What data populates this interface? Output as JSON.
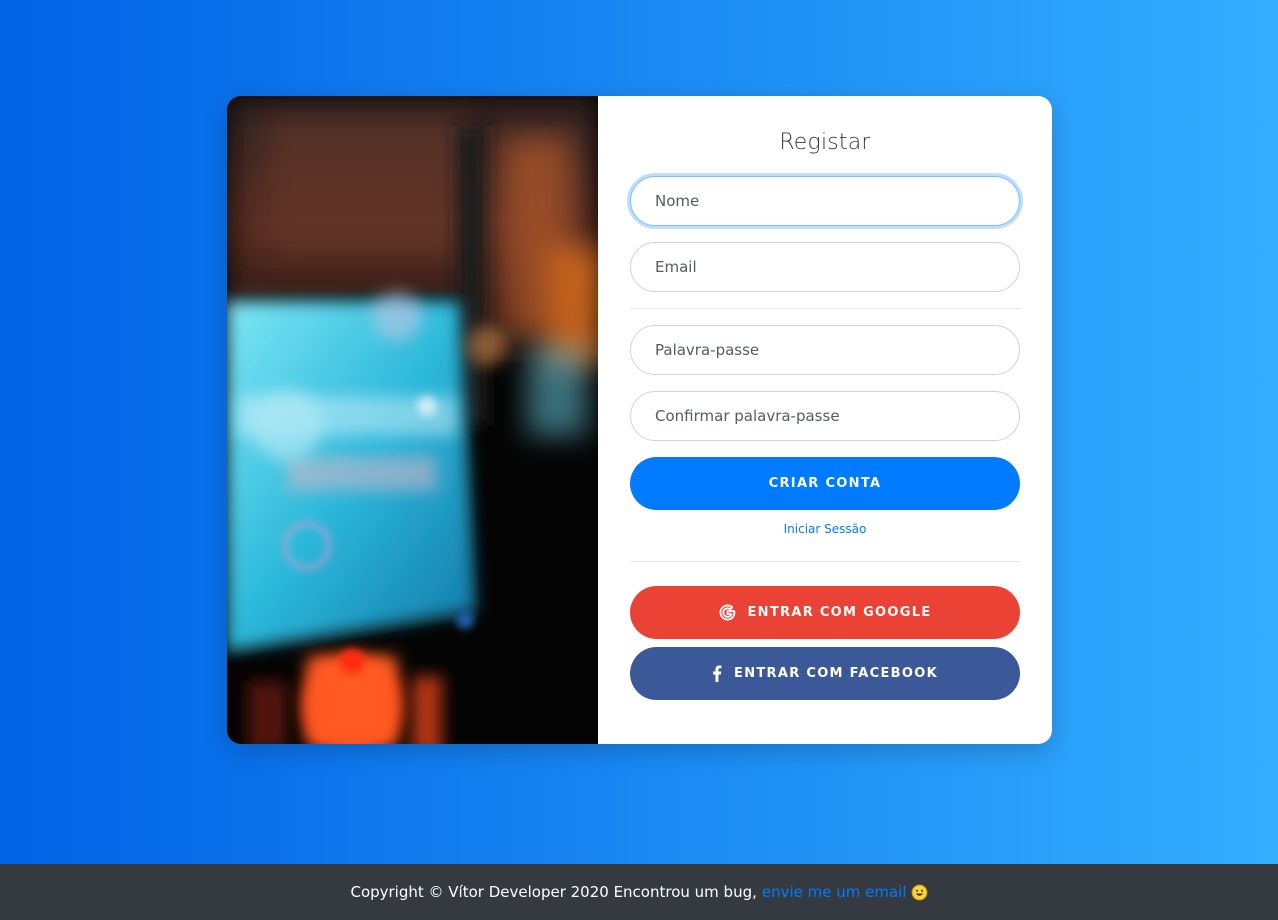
{
  "register": {
    "title": "Registar",
    "name_placeholder": "Nome",
    "email_placeholder": "Email",
    "password_placeholder": "Palavra-passe",
    "confirm_password_placeholder": "Confirmar palavra-passe",
    "submit_label": "CRIAR CONTA",
    "login_link": "Iniciar Sessão",
    "google_label": "ENTRAR COM GOOGLE",
    "facebook_label": "ENTRAR COM FACEBOOK"
  },
  "footer": {
    "text": "Copyright © Vítor Developer 2020 Encontrou um bug,",
    "link": "envie me um email",
    "emoji_icon": "grinning-face-icon"
  },
  "colors": {
    "background_gradient": [
      "#0062E6",
      "#33AEFF"
    ],
    "primary": "#007bff",
    "google": "#ea4335",
    "facebook": "#3b5998",
    "footer_bg": "#343a40"
  },
  "icons": [
    "google-icon",
    "facebook-icon",
    "grinning-face-icon"
  ]
}
